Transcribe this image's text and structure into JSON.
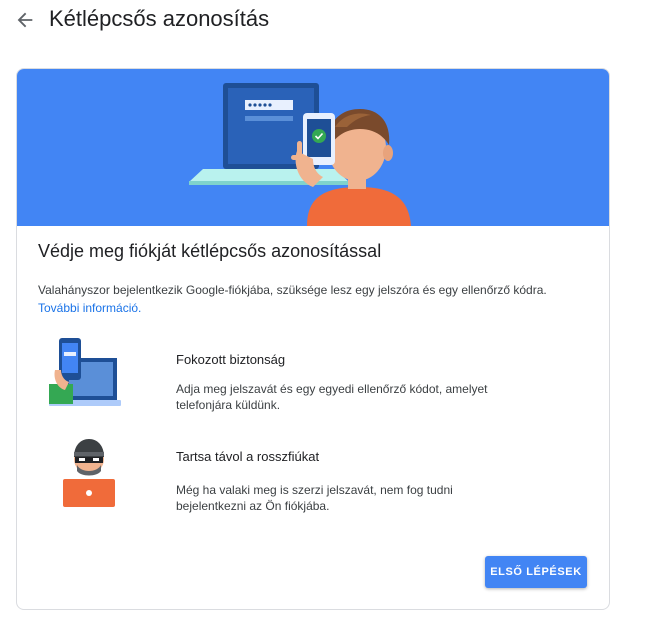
{
  "header": {
    "back_icon": "arrow-back-icon",
    "title": "Kétlépcsős azonosítás"
  },
  "card": {
    "heading": "Védje meg fiókját kétlépcsős azonosítással",
    "intro_text": "Valahányszor bejelentkezik Google-fiókjába, szüksége lesz egy jelszóra és egy ellenőrző kódra.",
    "learn_more": "További információ.",
    "features": [
      {
        "icon": "phone-laptop-illustration",
        "title": "Fokozott biztonság",
        "description": "Adja meg jelszavát és egy egyedi ellenőrző kódot, amelyet telefonjára küldünk."
      },
      {
        "icon": "thief-laptop-illustration",
        "title": "Tartsa távol a rosszfiúkat",
        "description": "Még ha valaki meg is szerzi jelszavát, nem fog tudni bejelentkezni az Ön fiókjába."
      }
    ],
    "cta_label": "ELSŐ LÉPÉSEK"
  },
  "colors": {
    "hero_background": "#4285f4",
    "primary_button": "#4285f4",
    "link": "#1a73e8",
    "person_shirt": "#f06b3a",
    "laptop_screen": "#1e4f96"
  }
}
